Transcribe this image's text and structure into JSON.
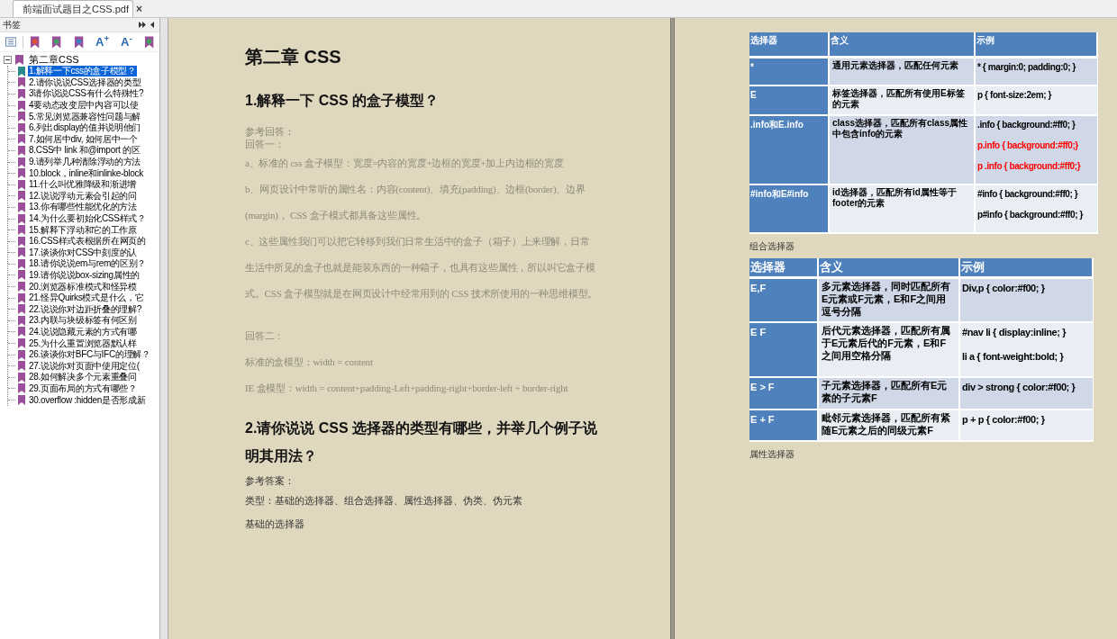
{
  "tab": {
    "title": "前端面试题目之CSS.pdf",
    "close": "×"
  },
  "sidebar": {
    "title": "书签",
    "font_buttons": [
      "A$^{+}$",
      "A$^{-}$"
    ],
    "tree": {
      "label": "第二章CSS",
      "expanded": true,
      "children": [
        {
          "label": "1.解释一下css的盒子模型？",
          "selected": true
        },
        {
          "label": "2.请你说说CSS选择器的类型",
          "selected": false
        },
        {
          "label": "3请你说说CSS有什么特殊性?",
          "selected": false
        },
        {
          "label": "4要动态改变层中内容可以使",
          "selected": false
        },
        {
          "label": "5.常见浏览器兼容性问题与解",
          "selected": false
        },
        {
          "label": "6.列出display的值并说明他们",
          "selected": false
        },
        {
          "label": "7.如何居中div, 如何居中一个",
          "selected": false
        },
        {
          "label": "8.CSS中 link 和@import 的区",
          "selected": false
        },
        {
          "label": "9.请列举几种清除浮动的方法",
          "selected": false
        },
        {
          "label": "10.block，inline和inlinke-block",
          "selected": false
        },
        {
          "label": "11.什么叫优雅降级和渐进增",
          "selected": false
        },
        {
          "label": "12.说说浮动元素会引起的问",
          "selected": false
        },
        {
          "label": "13.你有哪些性能优化的方法",
          "selected": false
        },
        {
          "label": "14.为什么要初始化CSS样式？",
          "selected": false
        },
        {
          "label": "15.解释下浮动和它的工作原",
          "selected": false
        },
        {
          "label": "16.CSS样式表根据所在网页的",
          "selected": false
        },
        {
          "label": "17.谈谈你对CSS中刻度的认",
          "selected": false
        },
        {
          "label": "18.请你说说em与rem的区别？",
          "selected": false
        },
        {
          "label": "19.请你说说box-sizing属性的",
          "selected": false
        },
        {
          "label": "20.浏览器标准模式和怪异模",
          "selected": false
        },
        {
          "label": "21.怪异Quirks模式是什么，它",
          "selected": false
        },
        {
          "label": "22.说说你对边距折叠的理解?",
          "selected": false
        },
        {
          "label": "23.内联与块级标签有何区别",
          "selected": false
        },
        {
          "label": "24.说说隐藏元素的方式有哪",
          "selected": false
        },
        {
          "label": "25.为什么重置浏览器默认样",
          "selected": false
        },
        {
          "label": "26.谈谈你对BFC与IFC的理解？",
          "selected": false
        },
        {
          "label": "27.说说你对页面中使用定位(",
          "selected": false
        },
        {
          "label": "28.如何解决多个元素重叠问",
          "selected": false
        },
        {
          "label": "29.页面布局的方式有哪些？",
          "selected": false
        },
        {
          "label": "30.overflow :hidden是否形成新",
          "selected": false
        }
      ]
    }
  },
  "left_page": [
    {
      "kind": "title",
      "text": "第二章  CSS"
    },
    {
      "kind": "heading",
      "text": "1.解释一下 CSS 的盒子模型？"
    },
    {
      "kind": "note",
      "text": "参考回答："
    },
    {
      "kind": "note",
      "text": "回答一："
    },
    {
      "kind": "paragraph",
      "text": "a、标准的 css 盒子模型：宽度=内容的宽度+边框的宽度+加上内边框的宽度"
    },
    {
      "kind": "paragraph",
      "text": "b、网页设计中常听的属性名：内容(content)、填充(padding)、边框(border)、边界(margin)，  CSS 盒子模式都具备这些属性。"
    },
    {
      "kind": "paragraph",
      "text": "c、这些属性我们可以把它转移到我们日常生活中的盒子（箱子）上来理解，日常生活中所见的盒子也就是能装东西的一种箱子，也具有这些属性，所以叫它盒子模式。CSS 盒子模型就是在网页设计中经常用到的 CSS 技术所使用的一种思维模型。"
    },
    {
      "kind": "paragraph",
      "text": "回答二："
    },
    {
      "kind": "paragraph",
      "text": "标准的盒模型：width = content"
    },
    {
      "kind": "paragraph",
      "text": "IE 盒模型：width = content+padding-Left+padding-right+border-left + border-right"
    },
    {
      "kind": "heading",
      "text": "2.请你说说 CSS 选择器的类型有哪些，并举几个例子说明其用法？"
    },
    {
      "kind": "text",
      "text": "参考答案："
    },
    {
      "kind": "text",
      "text": "类型：基础的选择器、组合选择器、属性选择器、伪类、伪元素"
    },
    {
      "kind": "text",
      "text": "基础的选择器"
    }
  ],
  "right_page": [
    {
      "kind": "table",
      "columns": [
        "选择器",
        "含义",
        "示例"
      ],
      "rows": [
        {
          "selector": "*",
          "meaning": "通用元素选择器，匹配任何元素",
          "examples": [
            {
              "text": "* { margin:0; padding:0; }",
              "color": "#000000"
            }
          ]
        },
        {
          "selector": "E",
          "meaning": "标签选择器，匹配所有使用E标签的元素",
          "examples": [
            {
              "text": "p { font-size:2em; }",
              "color": "#000000"
            }
          ]
        },
        {
          "selector": ".info和E.info",
          "meaning": "class选择器，匹配所有class属性中包含info的元素",
          "examples": [
            {
              "text": ".info { background:#ff0; }",
              "color": "#000000"
            },
            {
              "text": "p.info { background:#ff0;}",
              "color": "#ff0000"
            },
            {
              "text": "p  .info { background:#ff0;}",
              "color": "#ff0000"
            }
          ]
        },
        {
          "selector": "#info和E#info",
          "meaning": "id选择器，匹配所有id属性等于footer的元素",
          "examples": [
            {
              "text": "#info { background:#ff0; }",
              "color": "#000000"
            },
            {
              "text": "p#info { background:#ff0; }",
              "color": "#000000"
            }
          ]
        }
      ]
    },
    {
      "kind": "caption",
      "text": "组合选择器"
    },
    {
      "kind": "table",
      "columns": [
        "选择器",
        "含义",
        "示例"
      ],
      "rows": [
        {
          "selector": "E,F",
          "meaning": "多元素选择器，同时匹配所有E元素或F元素，E和F之间用逗号分隔",
          "examples": [
            {
              "text": "Div,p { color:#f00; }",
              "color": "#000000"
            }
          ]
        },
        {
          "selector": "E F",
          "meaning": "后代元素选择器，匹配所有属于E元素后代的F元素，E和F之间用空格分隔",
          "examples": [
            {
              "text": "#nav li { display:inline; }",
              "color": "#000000"
            },
            {
              "text": "li a { font-weight:bold; }",
              "color": "#000000"
            }
          ]
        },
        {
          "selector": "E > F",
          "meaning": "子元素选择器，匹配所有E元素的子元素F",
          "examples": [
            {
              "text": "div > strong { color:#f00; }",
              "color": "#000000"
            }
          ]
        },
        {
          "selector": "E + F",
          "meaning": "毗邻元素选择器，匹配所有紧随E元素之后的同级元素F",
          "examples": [
            {
              "text": "p + p { color:#f00; }",
              "color": "#000000"
            }
          ]
        }
      ]
    },
    {
      "kind": "caption",
      "text": "属性选择器"
    }
  ]
}
